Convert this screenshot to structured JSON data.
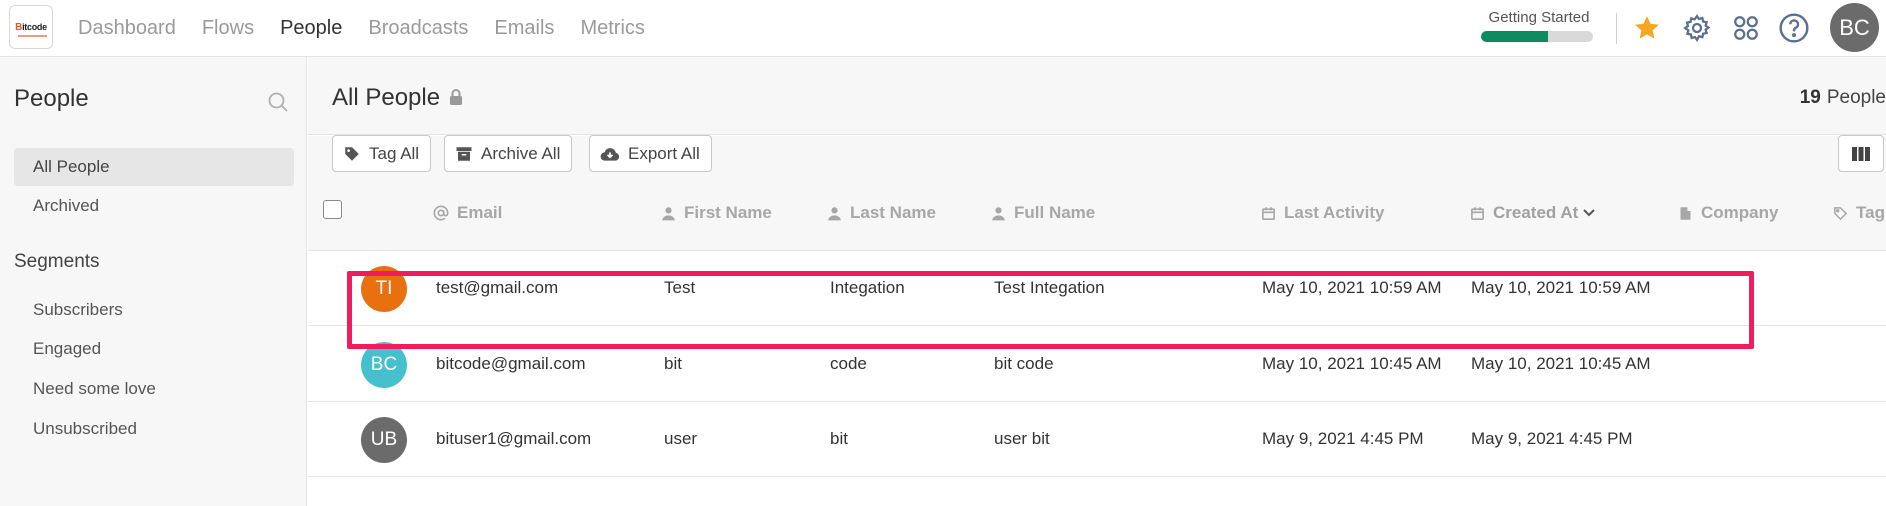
{
  "app": {
    "logo_b": "B",
    "logo_rest": "itcode"
  },
  "nav": {
    "items": [
      "Dashboard",
      "Flows",
      "People",
      "Broadcasts",
      "Emails",
      "Metrics"
    ],
    "active": "People"
  },
  "getting_started": {
    "label": "Getting Started",
    "progress_percent": 60
  },
  "user": {
    "initials": "BC"
  },
  "icons": {
    "star": "star-icon",
    "settings": "gear-icon",
    "apps": "grid-icon",
    "help": "question-icon",
    "search": "search-icon",
    "lock": "lock-icon"
  },
  "colors": {
    "accent_green": "#0e8a61",
    "star": "#f5a623",
    "highlight": "#f01d5c",
    "nav_icon": "#5b6f8f"
  },
  "sidebar": {
    "title": "People",
    "items": [
      {
        "label": "All People",
        "active": true
      },
      {
        "label": "Archived",
        "active": false
      }
    ],
    "segments_title": "Segments",
    "segments": [
      "Subscribers",
      "Engaged",
      "Need some love",
      "Unsubscribed"
    ]
  },
  "main": {
    "title": "All People",
    "count_number": "19",
    "count_label": "People",
    "toolbar": {
      "tag_all": "Tag All",
      "archive_all": "Archive All",
      "export_all": "Export All"
    }
  },
  "table": {
    "columns": {
      "email": "Email",
      "first_name": "First Name",
      "last_name": "Last Name",
      "full_name": "Full Name",
      "last_activity": "Last Activity",
      "created_at": "Created At",
      "company": "Company",
      "tags": "Tag"
    },
    "rows": [
      {
        "initials": "TI",
        "avatar_color": "#e8700f",
        "email": "test@gmail.com",
        "first_name": "Test",
        "last_name": "Integation",
        "full_name": "Test Integation",
        "last_activity": "May 10, 2021 10:59 AM",
        "created_at": "May 10, 2021 10:59 AM",
        "highlighted": true
      },
      {
        "initials": "BC",
        "avatar_color": "#45c1cd",
        "email": "bitcode@gmail.com",
        "first_name": "bit",
        "last_name": "code",
        "full_name": "bit code",
        "last_activity": "May 10, 2021 10:45 AM",
        "created_at": "May 10, 2021 10:45 AM",
        "highlighted": false
      },
      {
        "initials": "UB",
        "avatar_color": "#6b6b6b",
        "email": "bituser1@gmail.com",
        "first_name": "user",
        "last_name": "bit",
        "full_name": "user bit",
        "last_activity": "May 9, 2021 4:45 PM",
        "created_at": "May 9, 2021 4:45 PM",
        "highlighted": false
      }
    ]
  }
}
